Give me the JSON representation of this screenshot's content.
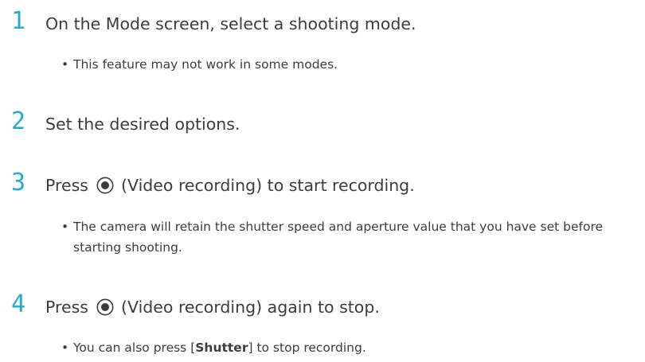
{
  "steps": [
    {
      "number": "1",
      "parts": {
        "text": "On the Mode screen, select a shooting mode."
      },
      "notes": [
        {
          "text": "This feature may not work in some modes."
        }
      ]
    },
    {
      "number": "2",
      "parts": {
        "text": "Set the desired options."
      },
      "notes": []
    },
    {
      "number": "3",
      "parts": {
        "before": "Press ",
        "icon": "video-record-icon",
        "after": " (Video recording) to start recording."
      },
      "notes": [
        {
          "text": "The camera will retain the shutter speed and aperture value that you have set before starting shooting."
        }
      ]
    },
    {
      "number": "4",
      "parts": {
        "before": "Press ",
        "icon": "video-record-icon",
        "after": " (Video recording) again to stop."
      },
      "notes": [
        {
          "before": "You can also press [",
          "bold": "Shutter",
          "after": "] to stop recording."
        }
      ]
    }
  ],
  "bullet_char": "•",
  "accent_color": "#28a9d1",
  "text_color": "#3c3c3c"
}
